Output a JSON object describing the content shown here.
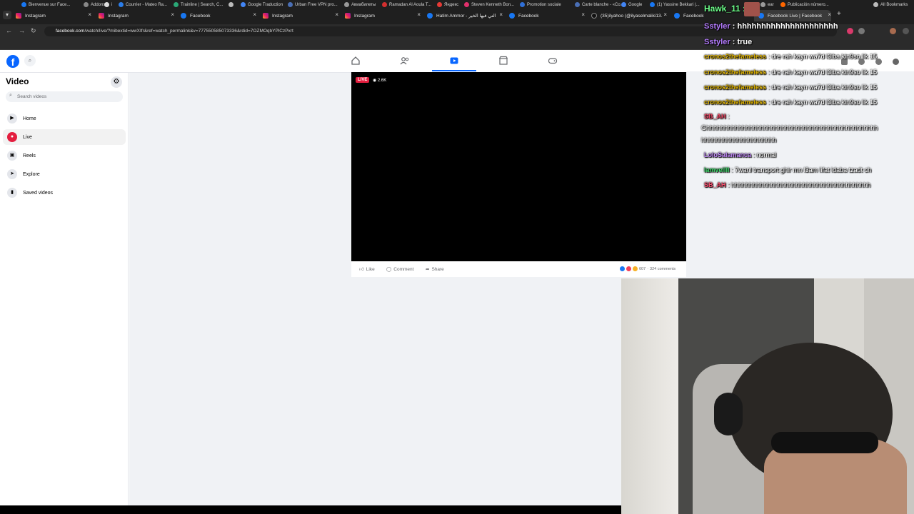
{
  "browser": {
    "tabs": [
      {
        "label": "Instagram",
        "icon": "instagram-icon"
      },
      {
        "label": "Instagram",
        "icon": "instagram-icon"
      },
      {
        "label": "Facebook",
        "icon": "facebook-icon"
      },
      {
        "label": "Instagram",
        "icon": "instagram-icon"
      },
      {
        "label": "Instagram",
        "icon": "instagram-icon"
      },
      {
        "label": "Hatim Ammor - التي فيها الخير",
        "icon": "facebook-icon"
      },
      {
        "label": "Facebook",
        "icon": "facebook-icon"
      },
      {
        "label": "(35)ilyahoo (@ilyaselmaliki13...",
        "icon": "tiktok-icon"
      },
      {
        "label": "Facebook",
        "icon": "facebook-icon"
      },
      {
        "label": "Facebook Live | Facebook",
        "icon": "facebook-icon"
      }
    ],
    "url_host": "facebook.com",
    "url_path": "/watch/live/?mibextid=wwXIfr&ref=watch_permalink&v=777550585073336&rdid=7OZMOqbYPlCzPxrt",
    "bookmarks": [
      "Bienvenue sur Face...",
      "Addons",
      "i",
      "Courrier - Mateo Ra...",
      "Trainline | Search, C...",
      "",
      "Google Traduction",
      "Urban Free VPN pro...",
      "Авиабилеты",
      "Ramadan Al Aoula T...",
      "Яндекс",
      "Steven Kenneth Bon...",
      "Promotion sociale",
      "Carte blanche - «Co...",
      "Google",
      "(1) Yassine Bekkari |...",
      "ear",
      "Publicación número...",
      "All Bookmarks"
    ]
  },
  "facebook": {
    "sidebar": {
      "title": "Video",
      "search_placeholder": "Search videos",
      "items": [
        {
          "label": "Home",
          "icon": "play-icon"
        },
        {
          "label": "Live",
          "icon": "live-icon"
        },
        {
          "label": "Reels",
          "icon": "reels-icon"
        },
        {
          "label": "Explore",
          "icon": "explore-icon"
        },
        {
          "label": "Saved videos",
          "icon": "bookmark-icon"
        }
      ]
    },
    "video": {
      "live_badge": "LIVE",
      "viewers": "2.6K",
      "actions": {
        "like": "Like",
        "comment": "Comment",
        "share": "Share"
      },
      "reaction_count": "607",
      "comments": "324 comments"
    }
  },
  "overlay": {
    "hawk": {
      "user": "Hawk_11",
      "sep": " :"
    },
    "sstyler1": {
      "user": "Sstyler",
      "text": " : hhhhhhhhhhhhhhhhhhhhh"
    },
    "sstyler2": {
      "user": "Sstyler",
      "text": " : true"
    },
    "chat": [
      {
        "user": "cronos2thefameless",
        "text": " : dre rah kayn wa7d l3iba kin9so lik 15",
        "color": "#e6b800"
      },
      {
        "user": "cronos2thefameless",
        "text": " : dre rah kayn wa7d l3iba kin9so lik 15",
        "color": "#e6b800"
      },
      {
        "user": "cronos2thefameless",
        "text": " : dre rah kayn wa7d l3iba kin9so lik 15",
        "color": "#e6b800"
      },
      {
        "user": "cronos2thefameless",
        "text": " : dre rah kayn wa7d l3iba kin9so lik 15",
        "color": "#e6b800"
      },
      {
        "user": "SB_AH",
        "text": " :",
        "color": "#ff4d6d"
      },
      {
        "user": "",
        "text": "Ghhhhhhhhhhhhhhhhhhhhhhhhhhhhhhhhhhhhhhhhhhhhhhhh",
        "color": "#ffffff"
      },
      {
        "user": "",
        "text": "hhhhhhhhhhhhhhhhhhhhh",
        "color": "#ffffff"
      },
      {
        "user": "LoloSalamanca",
        "text": " : normal",
        "color": "#c58bff"
      },
      {
        "user": "lamveilll",
        "text": " : 7wanl transport ghir mn l3am lifat ldaba tzadt ch",
        "color": "#3fd96b"
      },
      {
        "user": "SB_AH",
        "text": " : hhhhhhhhhhhhhhhhhhhhhhhhhhhhhhhhhhhhhhh",
        "color": "#ff4d6d"
      }
    ]
  }
}
